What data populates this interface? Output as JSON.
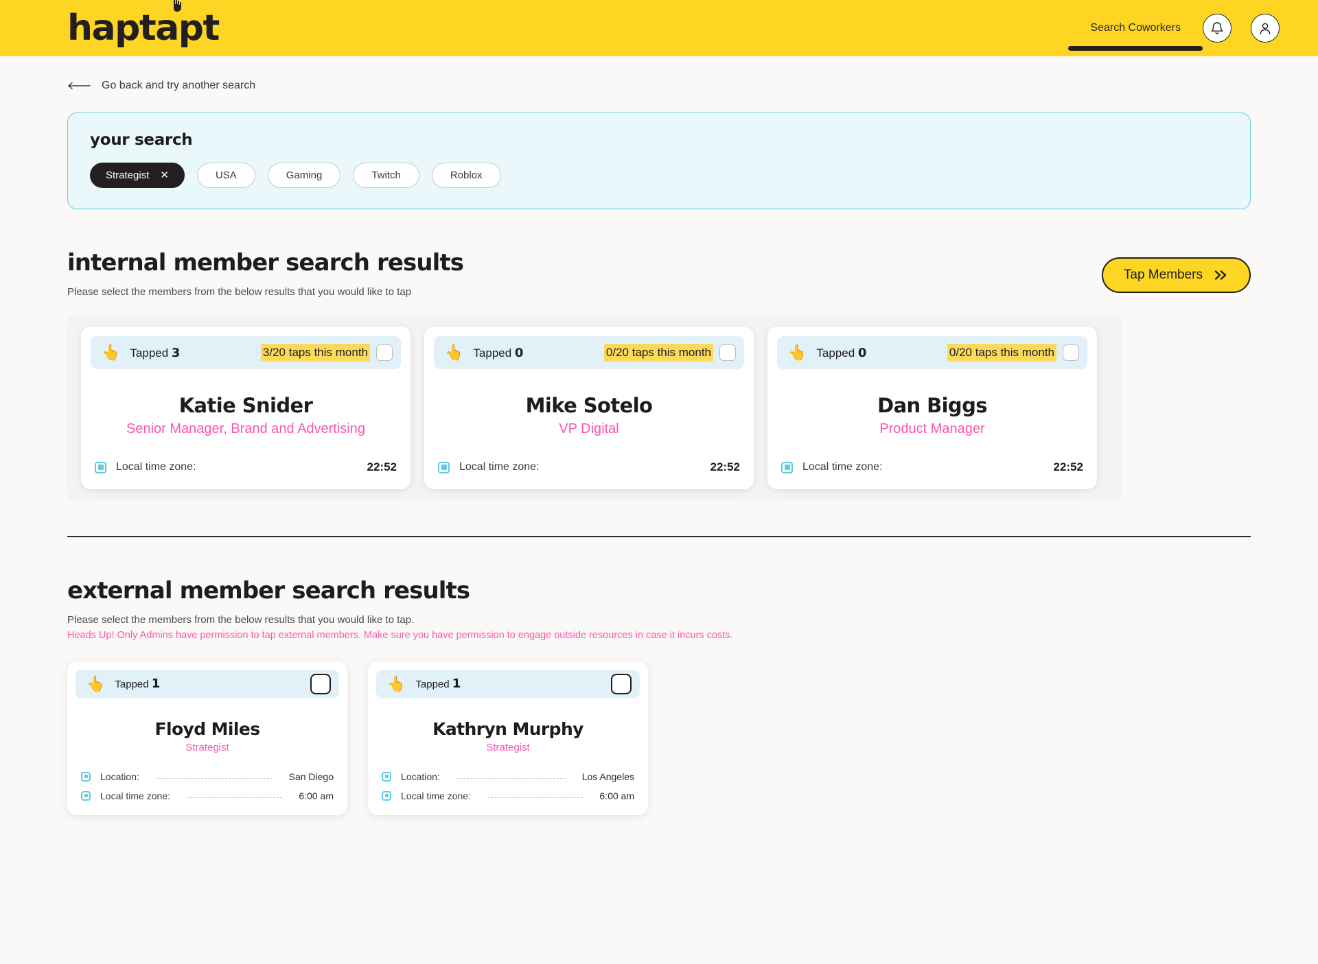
{
  "brand": {
    "name": "haptapt",
    "accent": "#fdd522",
    "pink": "#f957b0",
    "cyan": "#5ccde0"
  },
  "header": {
    "nav_label": "Search Coworkers",
    "bell_icon": "bell-icon",
    "profile_icon": "user-avatar-icon"
  },
  "backlink": {
    "label": "Go back and try another search",
    "icon": "arrow-left-icon"
  },
  "search": {
    "title": "your search",
    "chips": [
      {
        "label": "Strategist",
        "removable": true,
        "remove_glyph": "✕"
      },
      {
        "label": "USA",
        "removable": false
      },
      {
        "label": "Gaming",
        "removable": false
      },
      {
        "label": "Twitch",
        "removable": false
      },
      {
        "label": "Roblox",
        "removable": false
      }
    ]
  },
  "internal": {
    "title": "internal member search results",
    "subtitle": "Please select the members from the below results that you would like to tap",
    "tap_button": {
      "label": "Tap Members",
      "icon": "double-chevron-right-icon"
    },
    "cards": [
      {
        "tapped_label": "Tapped",
        "tapped_count": "3",
        "quota": "3/20 taps this month",
        "name": "Katie Snider",
        "role": "Senior Manager, Brand and Advertising",
        "rows": [
          {
            "label": "Local time zone:",
            "value": "22:52"
          }
        ]
      },
      {
        "tapped_label": "Tapped",
        "tapped_count": "0",
        "quota": "0/20 taps this month",
        "name": "Mike Sotelo",
        "role": "VP Digital",
        "rows": [
          {
            "label": "Local time zone:",
            "value": "22:52"
          }
        ]
      },
      {
        "tapped_label": "Tapped",
        "tapped_count": "0",
        "quota": "0/20 taps this month",
        "name": "Dan Biggs",
        "role": "Product Manager",
        "rows": [
          {
            "label": "Local time zone:",
            "value": "22:52"
          }
        ]
      }
    ]
  },
  "external": {
    "title": "external member search results",
    "subtitle": "Please select the members from the below results that you would like to tap.",
    "warning": "Heads Up! Only Admins have permission to tap external members. Make sure you have permission to engage outside resources in case it incurs costs.",
    "cards": [
      {
        "tapped_label": "Tapped",
        "tapped_count": "1",
        "name": "Floyd Miles",
        "role": "Strategist",
        "rows": [
          {
            "label": "Location:",
            "value": "San Diego"
          },
          {
            "label": "Local time zone:",
            "value": "6:00 am"
          }
        ]
      },
      {
        "tapped_label": "Tapped",
        "tapped_count": "1",
        "name": "Kathryn Murphy",
        "role": "Strategist",
        "rows": [
          {
            "label": "Location:",
            "value": "Los Angeles"
          },
          {
            "label": "Local time zone:",
            "value": "6:00 am"
          }
        ]
      }
    ]
  }
}
